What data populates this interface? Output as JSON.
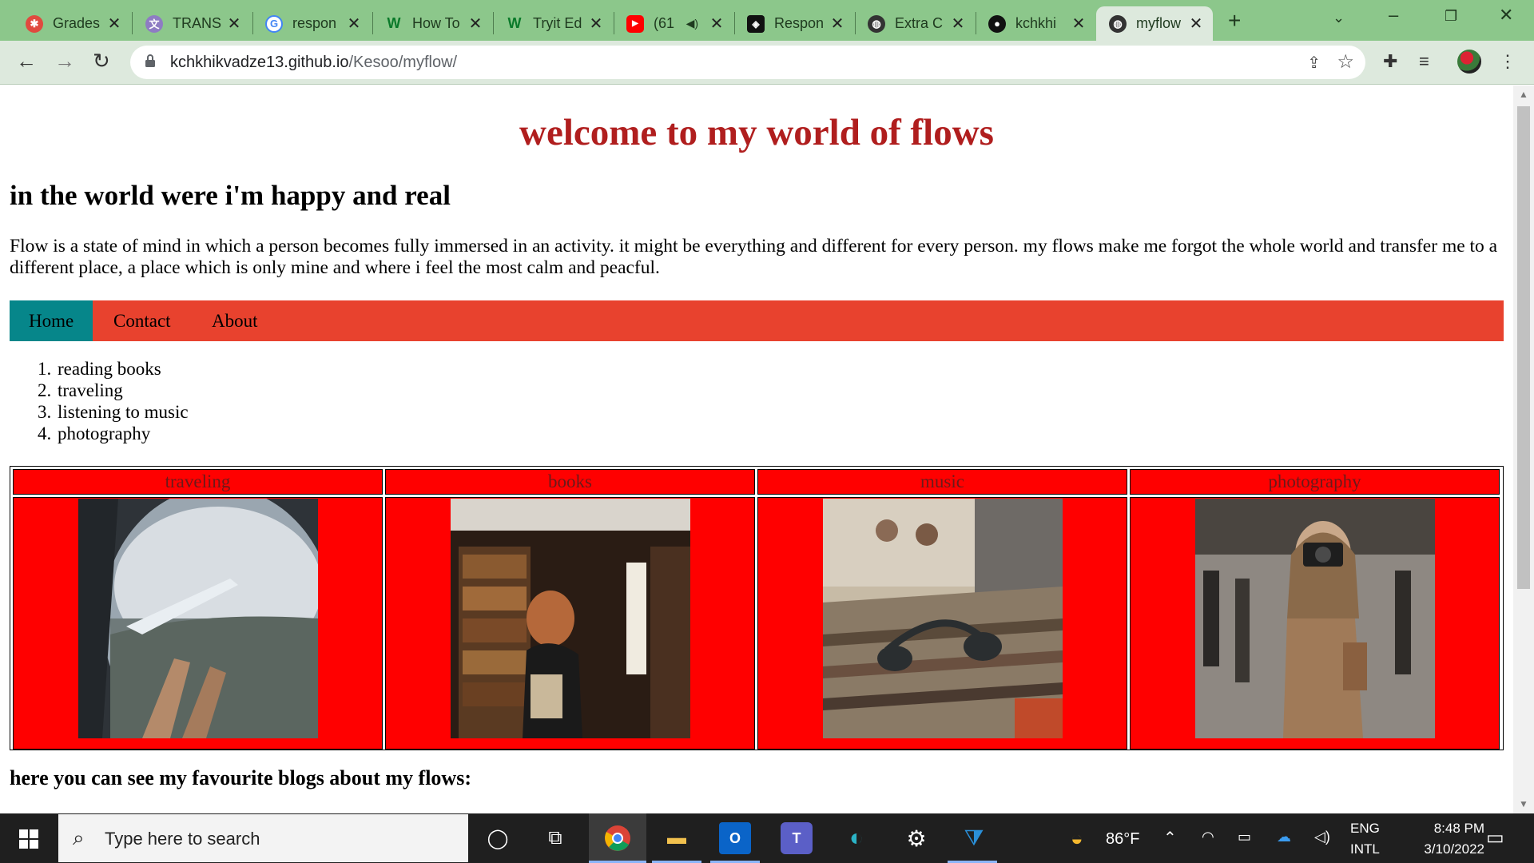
{
  "browser": {
    "tabs": [
      {
        "title": "Grades",
        "icon": "grades-icon",
        "color": "#e04a3f"
      },
      {
        "title": "TRANS",
        "icon": "translate-icon",
        "color": "#8e7cc3"
      },
      {
        "title": "respon",
        "icon": "google-icon",
        "color": "#4285f4"
      },
      {
        "title": "How To",
        "icon": "wix-icon",
        "color": "#0a8a3a"
      },
      {
        "title": "Tryit Ed",
        "icon": "w3schools-icon",
        "color": "#0a8a3a"
      },
      {
        "title": "(61",
        "icon": "youtube-icon",
        "color": "#ff0000"
      },
      {
        "title": "Respon",
        "icon": "codepen-icon",
        "color": "#111111"
      },
      {
        "title": "Extra C",
        "icon": "globe-icon",
        "color": "#333333"
      },
      {
        "title": "kchkhi",
        "icon": "github-icon",
        "color": "#111111"
      },
      {
        "title": "myflow",
        "icon": "globe-icon",
        "color": "#333333",
        "active": true
      }
    ],
    "url_host": "kchkhikvadze13.github.io",
    "url_path": "/Kesoo/myflow/"
  },
  "page": {
    "title": "welcome to my world of flows",
    "subtitle": "in the world were i'm happy and real",
    "intro": "Flow is a state of mind in which a person becomes fully immersed in an activity. it might be everything and different for every person. my flows make me forgot the whole world and transfer me to a different place, a place which is only mine and where i feel the most calm and peacful.",
    "nav": [
      "Home",
      "Contact",
      "About"
    ],
    "flows": [
      "reading books",
      "traveling",
      "listening to music",
      "photography"
    ],
    "gallery": [
      {
        "label": "traveling",
        "photo": "airplane-window-photo"
      },
      {
        "label": "books",
        "photo": "bookshop-photo"
      },
      {
        "label": "music",
        "photo": "vinyl-records-headphones-photo"
      },
      {
        "label": "photography",
        "photo": "woman-with-camera-photo"
      }
    ],
    "blogs_heading": "here you can see my favourite blogs about my flows:"
  },
  "colors": {
    "title": "#b01e1e",
    "navbar": "#e8422e",
    "nav_active": "#06868a",
    "gallery_bg": "#ff0000"
  },
  "taskbar": {
    "search_placeholder": "Type here to search",
    "weather": "86°F",
    "lang_top": "ENG",
    "lang_bottom": "INTL",
    "time": "8:48 PM",
    "date": "3/10/2022"
  }
}
